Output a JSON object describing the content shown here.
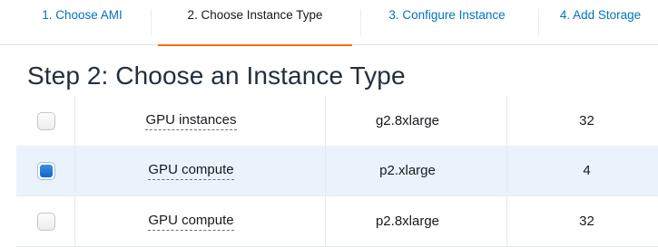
{
  "tabs": [
    {
      "label": "1. Choose AMI",
      "active": false
    },
    {
      "label": "2. Choose Instance Type",
      "active": true
    },
    {
      "label": "3. Configure Instance",
      "active": false
    },
    {
      "label": "4. Add Storage",
      "active": false
    }
  ],
  "heading": "Step 2: Choose an Instance Type",
  "rows": [
    {
      "selected": false,
      "family": "GPU instances",
      "type": "g2.8xlarge",
      "vcpus": "32"
    },
    {
      "selected": true,
      "family": "GPU compute",
      "type": "p2.xlarge",
      "vcpus": "4"
    },
    {
      "selected": false,
      "family": "GPU compute",
      "type": "p2.8xlarge",
      "vcpus": "32"
    }
  ],
  "colors": {
    "link": "#0073bb",
    "active_tab_underline": "#ec7211",
    "selected_row_bg": "#eaf3fb",
    "checkbox_checked": "#1f6fd0"
  }
}
